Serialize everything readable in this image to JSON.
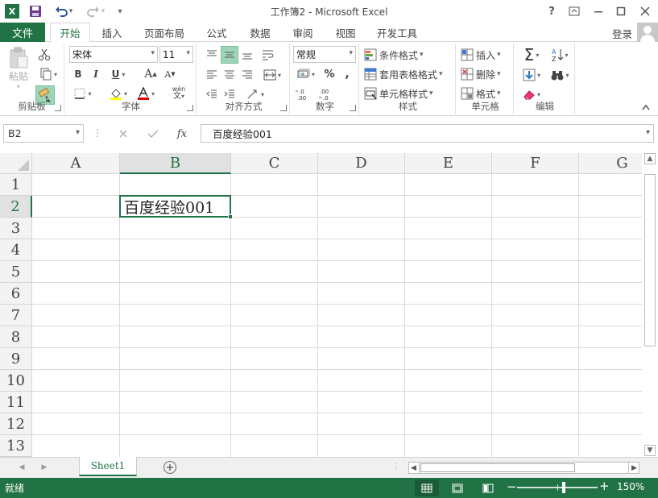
{
  "titlebar": {
    "app_icon": "X",
    "window_title": "工作簿2 - Microsoft Excel",
    "help": "?",
    "icons": {
      "save": "save-icon",
      "undo": "undo-icon",
      "redo": "redo-icon"
    }
  },
  "tabs": {
    "file": "文件",
    "items": [
      "开始",
      "插入",
      "页面布局",
      "公式",
      "数据",
      "审阅",
      "视图",
      "开发工具"
    ],
    "active": "开始",
    "login": "登录"
  },
  "ribbon": {
    "clipboard": {
      "label": "剪贴板",
      "paste": "粘贴"
    },
    "font": {
      "label": "字体",
      "font_name": "宋体",
      "font_size": "11",
      "bold": "B",
      "italic": "I",
      "underline": "U",
      "grow": "A",
      "shrink": "A",
      "phonetic": "wén"
    },
    "alignment": {
      "label": "对齐方式"
    },
    "number": {
      "label": "数字",
      "format": "常规",
      "percent": "%",
      "comma": ",",
      "inc_dec": "←.0\n.00",
      "dec_dec": ".00\n→.0"
    },
    "styles": {
      "label": "样式",
      "conditional": "条件格式",
      "table": "套用表格格式",
      "cell_styles": "单元格样式"
    },
    "cells": {
      "label": "单元格",
      "insert": "插入",
      "delete": "删除",
      "format": "格式"
    },
    "editing": {
      "label": "编辑",
      "sum": "Σ"
    }
  },
  "formula_bar": {
    "name_box": "B2",
    "fx": "fx",
    "content": "百度经验001"
  },
  "grid": {
    "columns": [
      "A",
      "B",
      "C",
      "D",
      "E",
      "F",
      "G"
    ],
    "rows": [
      "1",
      "2",
      "3",
      "4",
      "5",
      "6",
      "7",
      "8",
      "9",
      "10",
      "11",
      "12",
      "13"
    ],
    "selected_cell": "B2",
    "cell_b2": "百度经验001"
  },
  "sheets": {
    "tabs": [
      "Sheet1"
    ],
    "active": "Sheet1"
  },
  "status": {
    "text": "就绪",
    "zoom": "150%"
  },
  "colors": {
    "accent": "#217346",
    "selection_header": "#e1e1e1"
  }
}
